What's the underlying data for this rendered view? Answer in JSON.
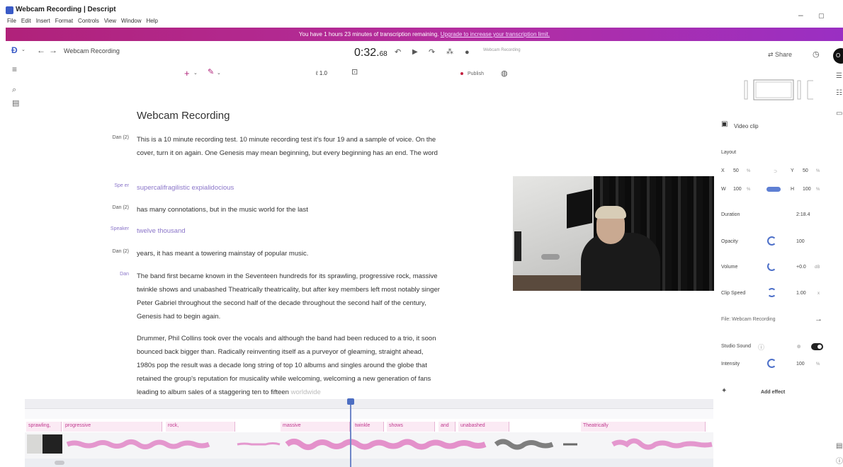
{
  "window": {
    "title": "Webcam Recording | Descript",
    "menu": [
      "File",
      "Edit",
      "Insert",
      "Format",
      "Controls",
      "View",
      "Window",
      "Help"
    ],
    "minimize_glyph": "–",
    "maximize_glyph": "▢"
  },
  "promo": {
    "text": "You have 1 hours 23 minutes of transcription remaining.",
    "link": "Upgrade to increase your transcription limit."
  },
  "topbar": {
    "project_name": "Webcam Recording",
    "timecode_main": "0:32.",
    "timecode_frac": "68",
    "mini_label": "Webcam Recording",
    "share_label": "Share",
    "avatar_initial": "O"
  },
  "toolbar": {
    "zoom": "1.0",
    "publish_label": "Publish"
  },
  "document": {
    "title": "Webcam Recording",
    "paragraphs": [
      {
        "speaker": "Dan (2)",
        "text": "This is a 10 minute recording test. 10 minute recording test it's four 19 and a sample of voice. On the cover, turn it on again. One Genesis may mean beginning, but every beginning has an end. The word",
        "style": "normal"
      },
      {
        "speaker": "Spe   er",
        "text": "supercalifragilistic expialidocious",
        "style": "purple"
      },
      {
        "speaker": "Dan (2)",
        "text": "has many connotations, but in the music world for the last",
        "style": "normal"
      },
      {
        "speaker": "Speaker",
        "text": "twelve thousand",
        "style": "purple"
      },
      {
        "speaker": "Dan (2)",
        "text": "years, it has meant a towering mainstay of popular music.",
        "style": "normal"
      },
      {
        "speaker": "Dan",
        "text": "The band first became known in the Seventeen hundreds for its sprawling, progressive rock, massive twinkle shows and unabashed  Theatrically theatricality, but after key members left most notably singer Peter Gabriel throughout the second half of the decade throughout the second half of the century, Genesis had to begin again.",
        "style": "normal",
        "speaker_style": "purple"
      },
      {
        "speaker": "",
        "text": "Drummer, Phil Collins took over the vocals and although the band had been reduced to a trio, it soon bounced back bigger than. Radically reinventing itself as a purveyor of gleaming, straight ahead, 1980s pop the result was a decade long string of top 10 albums and singles around the globe that retained the group's reputation for musicality while welcoming, welcoming a new generation of fans leading to album sales of a staggering ten to fifteen",
        "tail": "worldwide",
        "style": "normal"
      }
    ]
  },
  "properties": {
    "section_title": "Video clip",
    "layout_label": "Layout",
    "x_label": "X",
    "x_value": "50",
    "x_unit": "%",
    "y_label": "Y",
    "y_value": "50",
    "y_unit": "%",
    "w_label": "W",
    "w_value": "100",
    "w_unit": "%",
    "h_label": "H",
    "h_value": "100",
    "h_unit": "%",
    "duration_label": "Duration",
    "duration_value": "2:18.4",
    "opacity_label": "Opacity",
    "opacity_value": "100",
    "volume_label": "Volume",
    "volume_value": "+0.0",
    "volume_unit": "dB",
    "clipspeed_label": "Clip Speed",
    "clipspeed_value": "1.00",
    "clipspeed_unit": "x",
    "file_label": "File: Webcam Recording",
    "studio_sound_label": "Studio Sound",
    "intensity_label": "Intensity",
    "intensity_value": "100",
    "intensity_unit": "%",
    "add_effect_label": "Add effect"
  },
  "timeline": {
    "words": [
      {
        "text": "sprawling,"
      },
      {
        "text": "progressive"
      },
      {
        "text": "rock,"
      },
      {
        "text": "massive"
      },
      {
        "text": "twinkle"
      },
      {
        "text": "shows"
      },
      {
        "text": "and"
      },
      {
        "text": "unabashed"
      },
      {
        "text": "Theatrically"
      }
    ]
  },
  "colors": {
    "accent": "#4d6ec2",
    "brand_magenta": "#b0227a",
    "waveform": "#e07fc3",
    "speaker_purple": "#8b76c9"
  },
  "icons": [
    "descript-logo-icon",
    "back-arrow-icon",
    "forward-arrow-icon",
    "menu-icon",
    "search-icon",
    "library-icon",
    "skip-back-icon",
    "play-icon",
    "skip-forward-icon",
    "scene-icon",
    "mic-icon",
    "add-icon",
    "brush-icon",
    "comment-icon",
    "globe-icon",
    "share-icon",
    "history-icon",
    "video-clip-icon",
    "help-icon",
    "chevron-right-icon",
    "magic-icon"
  ]
}
